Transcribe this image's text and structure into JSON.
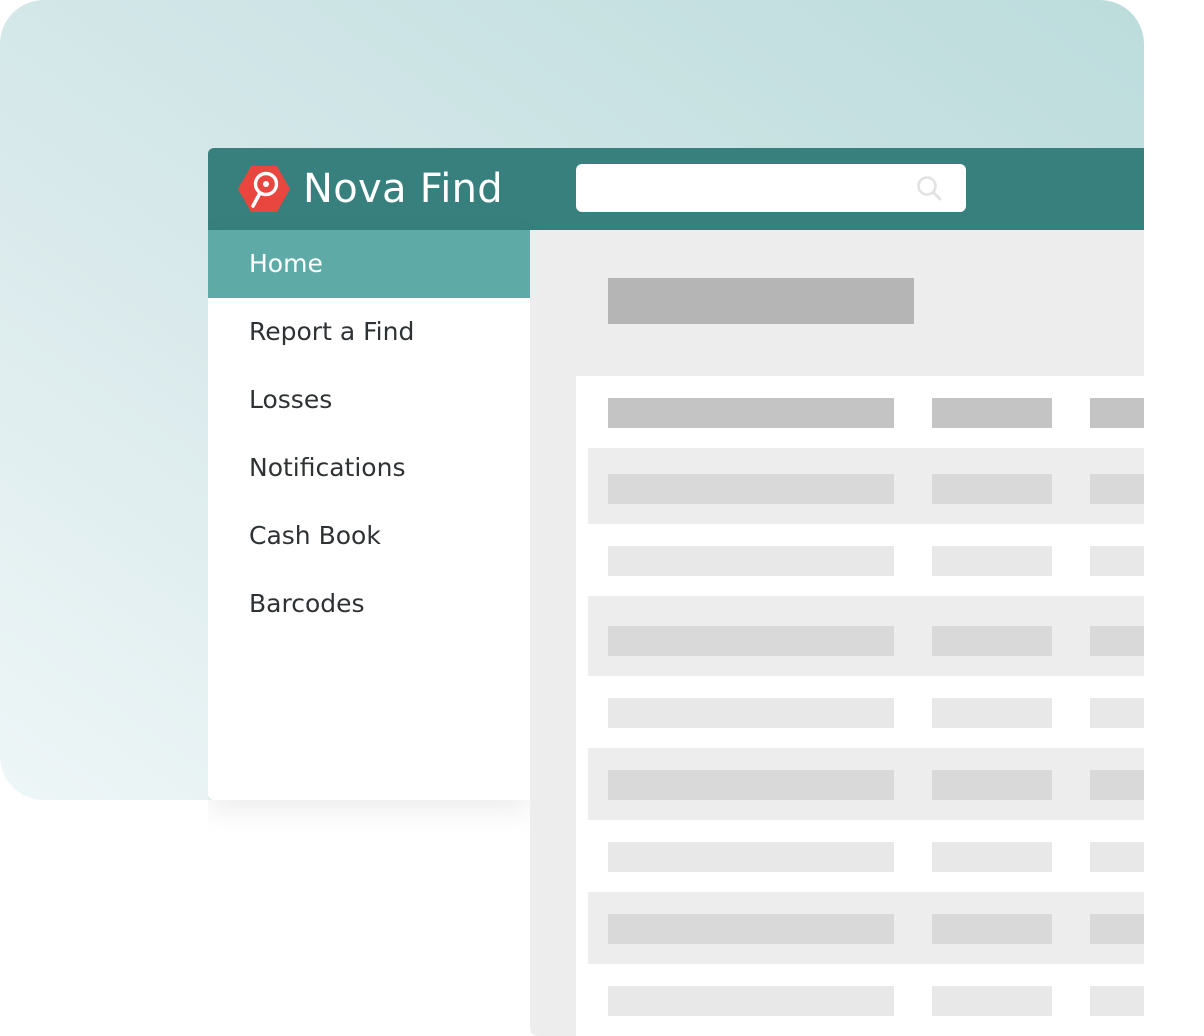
{
  "header": {
    "app_title": "Nova Find",
    "brand_color": "#e8463f",
    "bar_color": "#37807d",
    "logo_icon": "magnifier-pin-icon",
    "search": {
      "value": "",
      "placeholder": "",
      "icon": "search-icon"
    }
  },
  "sidebar": {
    "active_color": "#5eaaa7",
    "items": [
      {
        "label": "Home",
        "active": true
      },
      {
        "label": "Report a Find",
        "active": false
      },
      {
        "label": "Losses",
        "active": false
      },
      {
        "label": "Notifications",
        "active": false
      },
      {
        "label": "Cash Book",
        "active": false
      },
      {
        "label": "Barcodes",
        "active": false
      }
    ]
  },
  "content": {
    "placeholder_colors": {
      "heading": "#b5b5b5",
      "table_header": "#c4c4c4",
      "striped_row": "#d9d9d9",
      "plain_row": "#e8e8e8"
    },
    "table": {
      "header_row": true,
      "body_row_styles": [
        "striped",
        "plain",
        "striped",
        "plain",
        "striped",
        "plain",
        "striped",
        "plain"
      ]
    }
  }
}
